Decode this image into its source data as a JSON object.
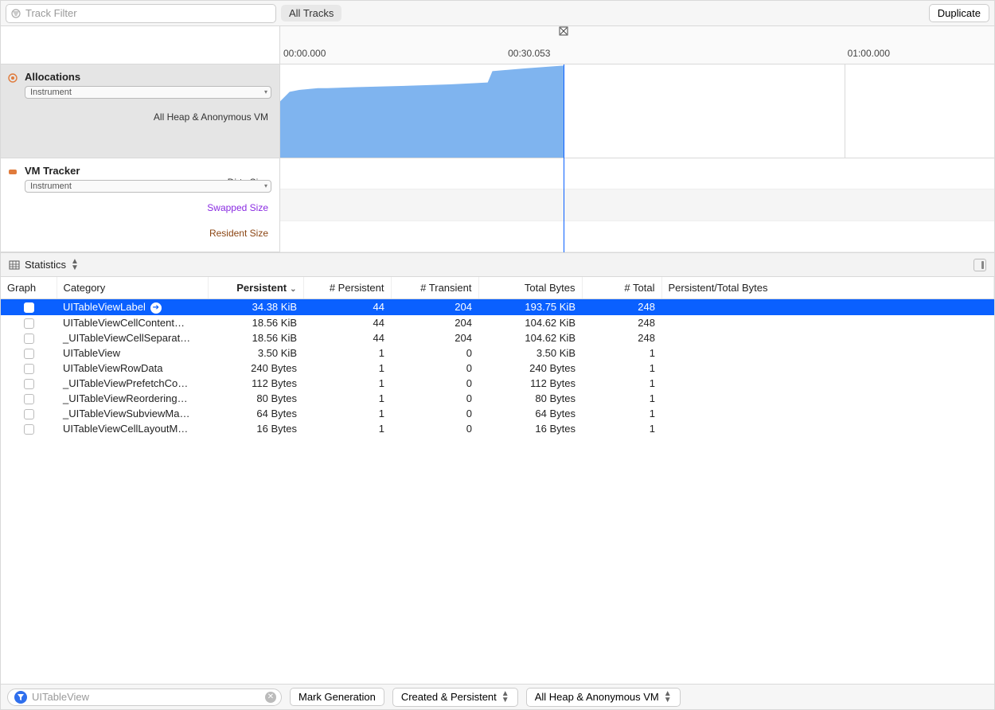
{
  "topbar": {
    "track_filter_placeholder": "Track Filter",
    "all_tracks_label": "All Tracks",
    "duplicate_label": "Duplicate"
  },
  "timeline": {
    "ticks": [
      "00:00.000",
      "00:30.053",
      "01:00.000"
    ],
    "playhead_fraction": 0.397,
    "grid_fraction": 0.79,
    "tracks": {
      "allocations": {
        "title": "Allocations",
        "badge": "Instrument",
        "sublabel": "All Heap & Anonymous VM"
      },
      "vm_tracker": {
        "title": "VM Tracker",
        "badge": "Instrument",
        "rows": {
          "dirty": "Dirty Size",
          "swapped": "Swapped Size",
          "resident": "Resident Size"
        }
      }
    }
  },
  "statistics_strip": {
    "label": "Statistics"
  },
  "table": {
    "columns": {
      "graph": "Graph",
      "category": "Category",
      "persistent": "Persistent",
      "n_persistent": "# Persistent",
      "n_transient": "# Transient",
      "total_bytes": "Total Bytes",
      "n_total": "# Total",
      "ratio": "Persistent/Total Bytes"
    },
    "rows": [
      {
        "category": "UITableViewLabel",
        "persistent": "34.38 KiB",
        "n_persistent": "44",
        "n_transient": "204",
        "total_bytes": "193.75 KiB",
        "n_total": "248",
        "selected": true,
        "disclosure": true
      },
      {
        "category": "UITableViewCellContent…",
        "persistent": "18.56 KiB",
        "n_persistent": "44",
        "n_transient": "204",
        "total_bytes": "104.62 KiB",
        "n_total": "248"
      },
      {
        "category": "_UITableViewCellSeparat…",
        "persistent": "18.56 KiB",
        "n_persistent": "44",
        "n_transient": "204",
        "total_bytes": "104.62 KiB",
        "n_total": "248"
      },
      {
        "category": "UITableView",
        "persistent": "3.50 KiB",
        "n_persistent": "1",
        "n_transient": "0",
        "total_bytes": "3.50 KiB",
        "n_total": "1"
      },
      {
        "category": "UITableViewRowData",
        "persistent": "240 Bytes",
        "n_persistent": "1",
        "n_transient": "0",
        "total_bytes": "240 Bytes",
        "n_total": "1"
      },
      {
        "category": "_UITableViewPrefetchCo…",
        "persistent": "112 Bytes",
        "n_persistent": "1",
        "n_transient": "0",
        "total_bytes": "112 Bytes",
        "n_total": "1"
      },
      {
        "category": "_UITableViewReordering…",
        "persistent": "80 Bytes",
        "n_persistent": "1",
        "n_transient": "0",
        "total_bytes": "80 Bytes",
        "n_total": "1"
      },
      {
        "category": "_UITableViewSubviewMa…",
        "persistent": "64 Bytes",
        "n_persistent": "1",
        "n_transient": "0",
        "total_bytes": "64 Bytes",
        "n_total": "1"
      },
      {
        "category": "UITableViewCellLayoutM…",
        "persistent": "16 Bytes",
        "n_persistent": "1",
        "n_transient": "0",
        "total_bytes": "16 Bytes",
        "n_total": "1"
      }
    ]
  },
  "bottombar": {
    "filter_value": "UITableView",
    "mark_generation": "Mark Generation",
    "created_persistent": "Created & Persistent",
    "heap_anon": "All Heap & Anonymous VM"
  },
  "chart_data": {
    "type": "area",
    "title": "All Heap & Anonymous VM",
    "x_range_seconds": [
      0,
      30.053
    ],
    "y_units": "relative (0–1)",
    "series": [
      {
        "name": "Allocations",
        "x": [
          0,
          1,
          2,
          3,
          4,
          5,
          8,
          12,
          18,
          22,
          22.5,
          26,
          30.053
        ],
        "y": [
          0.6,
          0.7,
          0.72,
          0.73,
          0.74,
          0.74,
          0.75,
          0.76,
          0.78,
          0.8,
          0.92,
          0.95,
          0.98
        ]
      }
    ],
    "playhead_seconds": 30.053,
    "colors": {
      "fill": "#7fb4ef"
    }
  }
}
